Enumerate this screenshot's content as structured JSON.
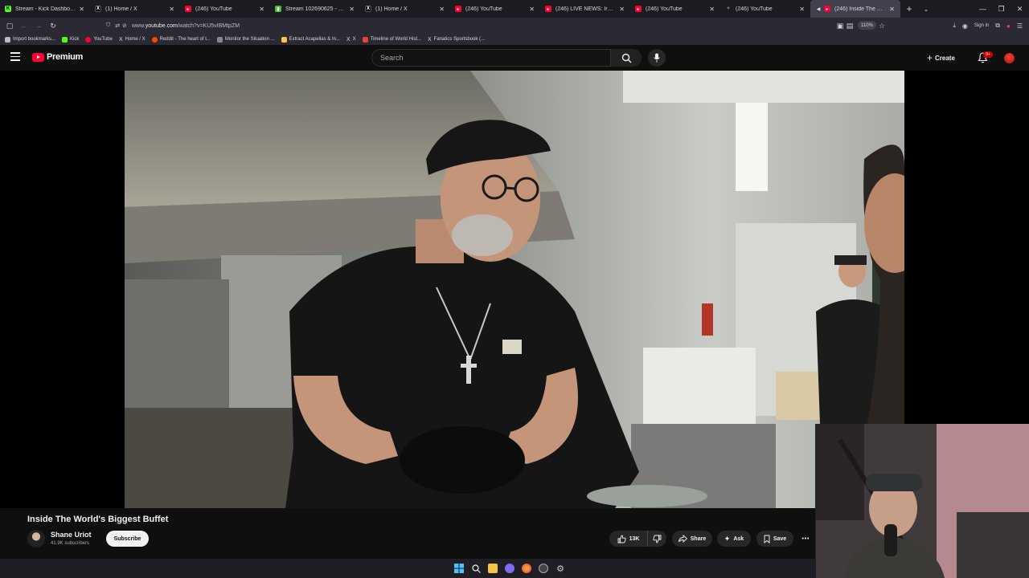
{
  "browser": {
    "tabs": [
      {
        "label": "Stream - Kick Dashboard",
        "icon": "kick-icon",
        "color": "#53fc18"
      },
      {
        "label": "(1) Home / X",
        "icon": "x-icon",
        "color": "#000000"
      },
      {
        "label": "(246) YouTube",
        "icon": "youtube-icon",
        "color": "#ff0033"
      },
      {
        "label": "Stream 102690625 - garydavid",
        "icon": "stream-icon",
        "color": "#4fbf3a"
      },
      {
        "label": "(1) Home / X",
        "icon": "x-icon",
        "color": "#000000"
      },
      {
        "label": "(246) YouTube",
        "icon": "youtube-icon",
        "color": "#ff0033"
      },
      {
        "label": "(246) LIVE NEWS: Iran war latest",
        "icon": "youtube-icon",
        "color": "#ff0033"
      },
      {
        "label": "(246) YouTube",
        "icon": "youtube-icon",
        "color": "#ff0033"
      },
      {
        "label": "(246) YouTube",
        "icon": "new-tab-icon",
        "color": "#888888"
      },
      {
        "label": "(246) Inside The World's Bi",
        "icon": "youtube-icon",
        "color": "#ff0033",
        "active": true
      }
    ],
    "url_prefix": "www.",
    "url_domain": "youtube.com",
    "url_path": "/watch?v=KU5vIBMtpZM",
    "zoom": "110%",
    "signin_label": "Sign in",
    "bookmarks": [
      {
        "label": "Import bookmarks...",
        "color": "#bbbbbb"
      },
      {
        "label": "Kick",
        "color": "#53fc18"
      },
      {
        "label": "YouTube",
        "color": "#ff0033"
      },
      {
        "label": "Home / X",
        "color": "#ffffff"
      },
      {
        "label": "Reddit - The heart of t...",
        "color": "#ff4500"
      },
      {
        "label": "Monitor the Situation ...",
        "color": "#888888"
      },
      {
        "label": "Extract Acapellas & In...",
        "color": "#f2c94c"
      },
      {
        "label": "X",
        "color": "#ffffff"
      },
      {
        "label": "Timeline of World Hist...",
        "color": "#e0453a"
      },
      {
        "label": "Fanatics Sportsbook (...",
        "color": "#ffffff"
      }
    ]
  },
  "youtube": {
    "brand": "Premium",
    "search_placeholder": "Search",
    "create_label": "Create",
    "notification_count": "9+",
    "video": {
      "title": "Inside The World's Biggest Buffet",
      "channel": "Shane Uriot",
      "subscribers": "41.9K subscribers",
      "subscribe_label": "Subscribe",
      "likes": "13K",
      "share_label": "Share",
      "ask_label": "Ask",
      "save_label": "Save"
    }
  },
  "colors": {
    "yt_red": "#ff0033",
    "background": "#0f0f0f",
    "browser_chrome": "#2b2a33"
  }
}
